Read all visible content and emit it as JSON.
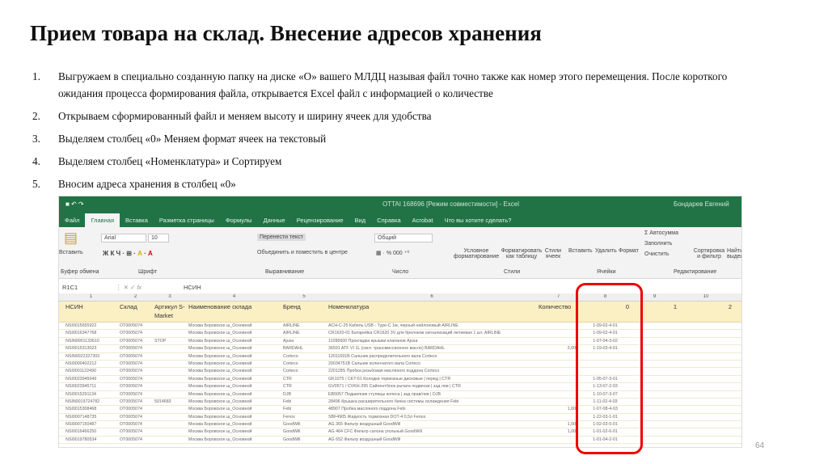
{
  "title": "Прием товара на склад. Внесение адресов хранения",
  "steps": [
    {
      "n": "1.",
      "text": "Выгружаем в специально созданную папку на диске «O» вашего МЛДЦ называя файл точно также как номер этого перемещения. После короткого ожидания процесса формирования файла, открывается Excel файл с информацией о количестве"
    },
    {
      "n": "2.",
      "text": "Открываем сформированный файл и меняем высоту и ширину ячеек для удобства"
    },
    {
      "n": "3.",
      "text": "Выделяем столбец «0» Меняем формат ячеек на текстовый"
    },
    {
      "n": "4.",
      "text": "Выделяем столбец «Номенклатура» и Сортируем"
    },
    {
      "n": "5.",
      "text": "Вносим адреса хранения в столбец «0»"
    }
  ],
  "excel": {
    "window_title": "OTTAI 168696 [Режим совместимости] - Excel",
    "user": "Бондарев Евгений",
    "tabs": [
      "Файл",
      "Главная",
      "Вставка",
      "Разметка страницы",
      "Формулы",
      "Данные",
      "Рецензирование",
      "Вид",
      "Справка",
      "Acrobat"
    ],
    "tell_me": "Что вы хотите сделать?",
    "ribbon": {
      "paste": "Вставить",
      "clipboard": "Буфер обмена",
      "font": "Arial",
      "size": "10",
      "font_group": "Шрифт",
      "wrap": "Перенести текст",
      "merge": "Объединить и поместить в центре",
      "align_group": "Выравнивание",
      "number_format": "Общий",
      "number_group": "Число",
      "cond": "Условное форматирование",
      "as_table": "Форматировать как таблицу",
      "cell_styles": "Стили ячеек",
      "styles_group": "Стили",
      "insert": "Вставить",
      "delete": "Удалить",
      "format": "Формат",
      "cells_group": "Ячейки",
      "autosum": "Σ Автосумма",
      "fill": "Заполнить",
      "clear": "Очистить",
      "sort": "Сортировка и фильтр",
      "find": "Найти и выделить",
      "edit_group": "Редактирование"
    },
    "name_box": "R1C1",
    "formula": "НСИН",
    "col_numbers": [
      "1",
      "2",
      "3",
      "4",
      "5",
      "6",
      "7",
      "8",
      "9",
      "10"
    ],
    "headers": [
      "НСИН",
      "Склад",
      "Артикул S-Market",
      "Наименование склада",
      "Бренд",
      "Номенклатура",
      "Количество",
      "0",
      "1",
      "2"
    ],
    "rows": [
      [
        "NSI0015655922",
        "OT0005074",
        "",
        "Москва Боровское ш_Основной",
        "AIRLINE",
        "ACH-C-25 Кабель USB - Type-C 1м, черный нейлоновый AIRLINE",
        "",
        "1-09-02-4-01"
      ],
      [
        "NSI0016347768",
        "OT0005074",
        "",
        "Москва Боровское ш_Основной",
        "AIRLINE",
        "CR1620-01 Батарейка CR1620 3V для брелоков сигнализаций литиевая 1 шт. AIRLINE",
        "",
        "1-09-02-4-01"
      ],
      [
        "NSIN0001133610",
        "OT0005074",
        "STOP",
        "Москва Боровское ш_Основной",
        "Ajusa",
        "11095600 Прокладка крышки клапанов Ajusa",
        "",
        "1-07-04-3-02"
      ],
      [
        "NSI0015313023",
        "OT0005074",
        "",
        "Москва Боровское ш_Основной",
        "BARDAHL",
        "36591 ATF VI 1L (синт. трансмиссионное масло) BARDAHL",
        "2,000",
        "1-19-03-4-01"
      ],
      [
        "NSIN0022327303",
        "OT0005074",
        "",
        "Москва Боровское ш_Основной",
        "Corteco",
        "12011691B Сальник распределительного вала Corteco",
        "",
        ""
      ],
      [
        "NSI0000402212",
        "OT0005074",
        "",
        "Москва Боровское ш_Основной",
        "Corteco",
        "20034751B Сальник коленчатого вала Corteco",
        "",
        ""
      ],
      [
        "NSI0001122490",
        "OT0005074",
        "",
        "Москва Боровское ш_Основной",
        "Corteco",
        "220128S Пробка резьбовая масляного поддона Corteco",
        "",
        ""
      ],
      [
        "NSI0023945049",
        "OT0005074",
        "",
        "Москва Боровское ш_Основной",
        "CTR",
        "GK1075 / CKT-61 Колодки тормозные дисковые | перед | CTR",
        "",
        "1-05-07-3-01"
      ],
      [
        "NSI0023945711",
        "OT0005074",
        "",
        "Москва Боровское ш_Основной",
        "CTR",
        "GV0571 / CVKH-295 Сайлентблок рычага подвески | зад лев | CTR",
        "",
        "1-13-07-2-03"
      ],
      [
        "NSI0015291134",
        "OT0005074",
        "",
        "Москва Боровское ш_Основной",
        "DJB",
        "EB5057 Подшипник ступицы колеса | зад прав/лев | DJB",
        "",
        "1-10-07-3-07"
      ],
      [
        "NSIN0019724782",
        "OT0005074",
        "5014683",
        "Москва Боровское ш_Основной",
        "Febi",
        "28496 Крышка расширительного бачка системы охлаждения Febi",
        "",
        "1-11-02-4-03"
      ],
      [
        "NSI0015308468",
        "OT0005074",
        "",
        "Москва Боровское ш_Основной",
        "Febi",
        "48907 Пробка масляного поддона Febi",
        "1,000",
        "1-07-08-4-03"
      ],
      [
        "NSI0007148735",
        "OT0005074",
        "",
        "Москва Боровское ш_Основной",
        "Fenox",
        "SBF4905 Жидкость тормозная DOT-4 0,5л Fenox",
        "",
        "1-22-03-1-01"
      ],
      [
        "NSI0007150487",
        "OT0005074",
        "",
        "Москва Боровское ш_Основной",
        "GoodWill",
        "AG 365 Фильтр воздушный GoodWill",
        "1,000",
        "1-02-03-5-01"
      ],
      [
        "NSI0016466250",
        "OT0005074",
        "",
        "Москва Боровское ш_Основной",
        "GoodWill",
        "AG 464 CFC Фильтр салона угольный GoodWill",
        "1,000",
        "1-01-02-6-01"
      ],
      [
        "NSI0019780534",
        "OT0005074",
        "",
        "Москва Боровское ш_Основной",
        "GoodWill",
        "AG 652 Фильтр воздушный GoodWill",
        "",
        "1-01-04-2-01"
      ]
    ]
  },
  "page_number": "64"
}
